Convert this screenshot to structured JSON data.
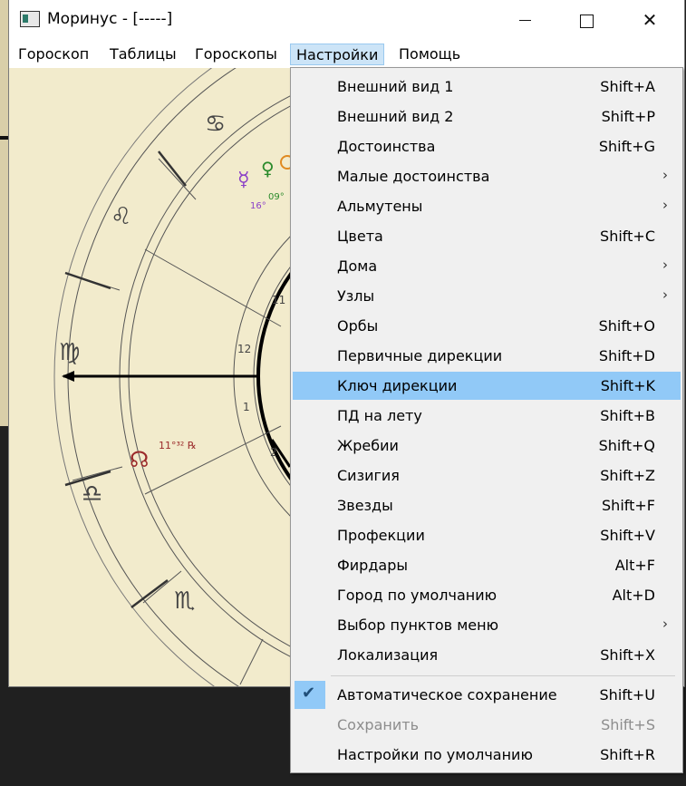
{
  "window": {
    "title": "Моринус - [-----]",
    "minimize_label": "—",
    "maximize_label": "☐",
    "close_label": "✕"
  },
  "menubar": {
    "items": [
      {
        "label": "Гороскоп",
        "active": false
      },
      {
        "label": "Таблицы",
        "active": false
      },
      {
        "label": "Гороскопы",
        "active": false
      },
      {
        "label": "Настройки",
        "active": true
      },
      {
        "label": "Помощь",
        "active": false
      }
    ]
  },
  "chart": {
    "house_numbers": [
      "11",
      "12",
      "1",
      "2"
    ],
    "planet_labels": [
      "09°",
      "16°",
      "11°³² ℞"
    ],
    "zodiac_glyphs": [
      "♋",
      "♌",
      "♍",
      "♎",
      "♏"
    ],
    "planet_glyphs": [
      "☿",
      "♀",
      "☊"
    ]
  },
  "dropdown": {
    "items": [
      {
        "label": "Внешний вид 1",
        "shortcut": "Shift+A"
      },
      {
        "label": "Внешний вид 2",
        "shortcut": "Shift+P"
      },
      {
        "label": "Достоинства",
        "shortcut": "Shift+G"
      },
      {
        "label": "Малые достоинства",
        "submenu": true
      },
      {
        "label": "Альмутены",
        "submenu": true
      },
      {
        "label": "Цвета",
        "shortcut": "Shift+C"
      },
      {
        "label": "Дома",
        "submenu": true
      },
      {
        "label": "Узлы",
        "submenu": true
      },
      {
        "label": "Орбы",
        "shortcut": "Shift+O"
      },
      {
        "label": "Первичные дирекции",
        "shortcut": "Shift+D"
      },
      {
        "label": "Ключ дирекции",
        "shortcut": "Shift+K",
        "highlighted": true
      },
      {
        "label": "ПД на лету",
        "shortcut": "Shift+B"
      },
      {
        "label": "Жребии",
        "shortcut": "Shift+Q"
      },
      {
        "label": "Сизигия",
        "shortcut": "Shift+Z"
      },
      {
        "label": "Звезды",
        "shortcut": "Shift+F"
      },
      {
        "label": "Профекции",
        "shortcut": "Shift+V"
      },
      {
        "label": "Фирдары",
        "shortcut": "Alt+F"
      },
      {
        "label": "Город по умолчанию",
        "shortcut": "Alt+D"
      },
      {
        "label": "Выбор пунктов меню",
        "submenu": true
      },
      {
        "label": "Локализация",
        "shortcut": "Shift+X"
      }
    ],
    "bottom_items": [
      {
        "label": "Автоматическое сохранение",
        "shortcut": "Shift+U",
        "checked": true
      },
      {
        "label": "Сохранить",
        "shortcut": "Shift+S",
        "disabled": true
      },
      {
        "label": "Настройки по умолчанию",
        "shortcut": "Shift+R"
      }
    ],
    "submenu_arrow": "›",
    "check_mark": "✔"
  },
  "colors": {
    "highlight": "#91c9f7",
    "chart_bg": "#f2ebcc",
    "menu_bg": "#f0f0f0"
  }
}
